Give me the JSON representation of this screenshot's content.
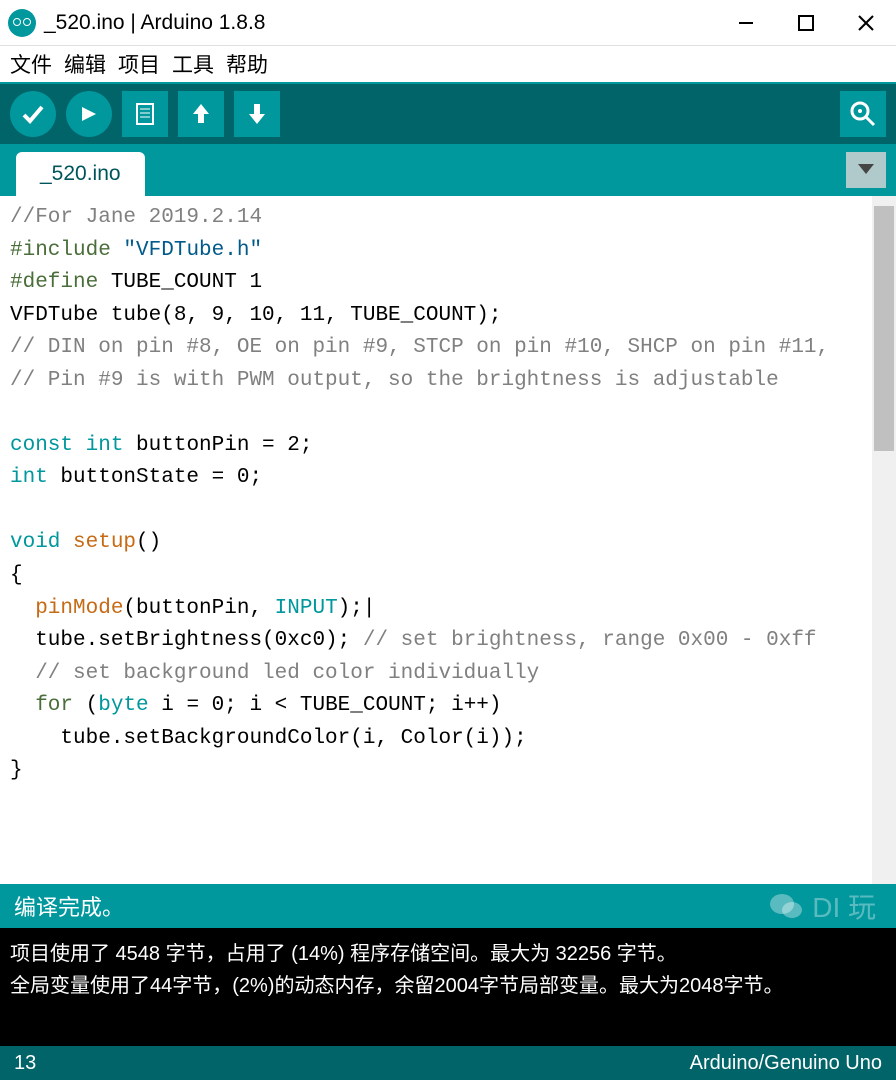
{
  "window": {
    "title": "_520.ino | Arduino 1.8.8"
  },
  "menu": {
    "file": "文件",
    "edit": "编辑",
    "sketch": "项目",
    "tools": "工具",
    "help": "帮助"
  },
  "tab": {
    "name": "_520.ino"
  },
  "code": {
    "l1": "//For Jane 2019.2.14",
    "l2a": "#include",
    "l2b": " \"VFDTube.h\"",
    "l3a": "#define",
    "l3b": " TUBE_COUNT 1",
    "l4": "VFDTube tube(8, 9, 10, 11, TUBE_COUNT);",
    "l5": "// DIN on pin #8, OE on pin #9, STCP on pin #10, SHCP on pin #11,",
    "l6": "// Pin #9 is with PWM output, so the brightness is adjustable",
    "l7": "",
    "l8a": "const",
    "l8b": " int",
    "l8c": " buttonPin = 2;",
    "l9a": "int",
    "l9b": " buttonState = 0;",
    "l10": "",
    "l11a": "void",
    "l11b": " setup",
    "l11c": "()",
    "l12": "{",
    "l13a": "  pinMode",
    "l13b": "(buttonPin, ",
    "l13c": "INPUT",
    "l13d": ");",
    "l14a": "  tube.setBrightness(0xc0); ",
    "l14b": "// set brightness, range 0x00 - 0xff",
    "l15": "  // set background led color individually",
    "l16a": "  for",
    "l16b": " (",
    "l16c": "byte",
    "l16d": " i = 0; i < TUBE_COUNT; i++)",
    "l17": "    tube.setBackgroundColor(i, Color(i));",
    "l18": "}"
  },
  "status": {
    "compile": "编译完成。",
    "watermark": "DI 玩"
  },
  "console": {
    "line1": "项目使用了 4548 字节，占用了 (14%) 程序存储空间。最大为 32256 字节。",
    "line2": "全局变量使用了44字节，(2%)的动态内存，余留2004字节局部变量。最大为2048字节。"
  },
  "bottom": {
    "line": "13",
    "board": "Arduino/Genuino Uno"
  }
}
